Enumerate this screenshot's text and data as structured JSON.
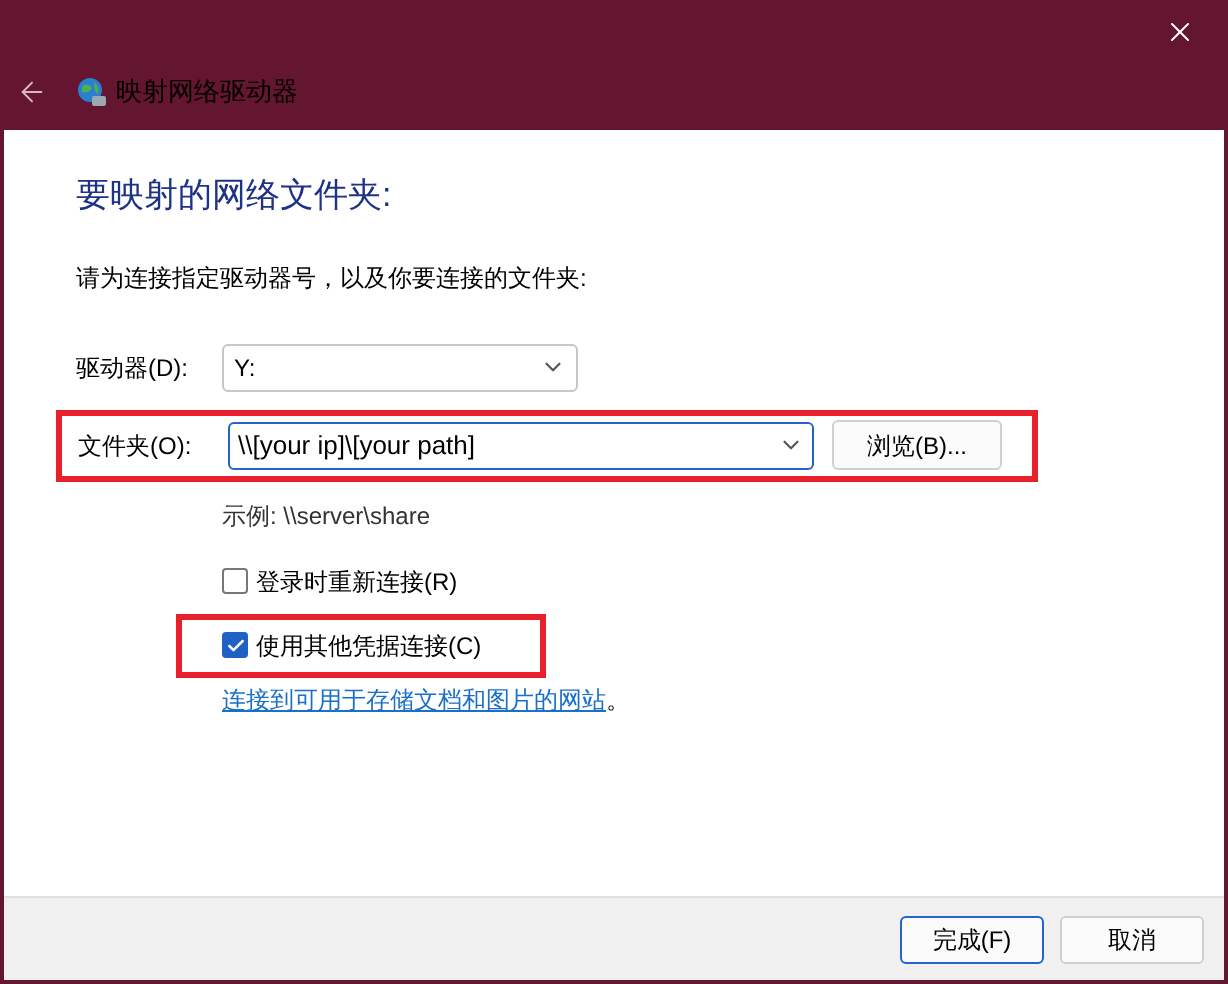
{
  "window": {
    "title": "映射网络驱动器"
  },
  "heading": "要映射的网络文件夹:",
  "instruction": "请为连接指定驱动器号，以及你要连接的文件夹:",
  "drive": {
    "label": "驱动器(D):",
    "value": "Y:"
  },
  "folder": {
    "label": "文件夹(O):",
    "value": "\\\\[your ip]\\[your path]",
    "browse": "浏览(B)...",
    "highlighted": true
  },
  "example": "示例: \\\\server\\share",
  "options": [
    {
      "label": "登录时重新连接(R)",
      "checked": false,
      "highlighted": false
    },
    {
      "label": "使用其他凭据连接(C)",
      "checked": true,
      "highlighted": true
    }
  ],
  "link": {
    "text": "连接到可用于存储文档和图片的网站",
    "suffix": "。"
  },
  "buttons": [
    {
      "label": "完成(F)",
      "default": true
    },
    {
      "label": "取消",
      "default": false
    }
  ]
}
